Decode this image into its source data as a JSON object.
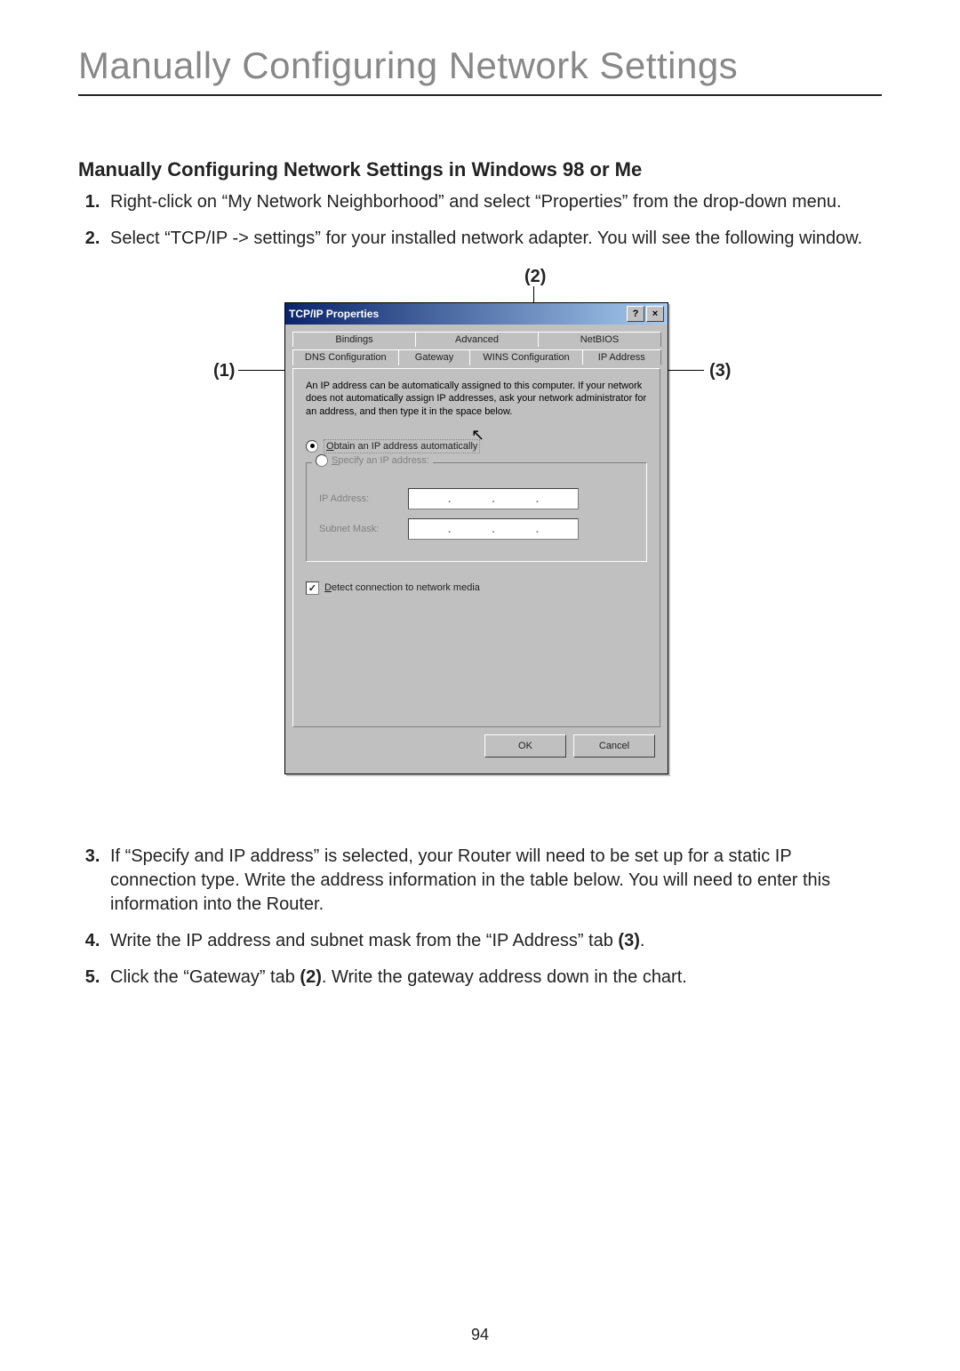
{
  "page": {
    "title": "Manually Configuring Network Settings",
    "heading": "Manually Configuring Network Settings in Windows 98 or Me",
    "page_number": "94"
  },
  "steps": {
    "s1": "Right-click on “My Network Neighborhood” and select “Properties” from the drop-down menu.",
    "s2": "Select “TCP/IP -> settings” for your installed network adapter. You will see the following window.",
    "s3_a": "If “Specify and IP address” is selected, your Router will need to be set up for a static IP connection type. Write the address information in the table below. You will need to enter this information into the Router.",
    "s4_a": "Write the IP address and subnet mask from the “IP Address” tab ",
    "s4_b": "(3)",
    "s4_c": ".",
    "s5_a": "Click the “Gateway” tab ",
    "s5_b": "(2)",
    "s5_c": ". Write the gateway address down in the chart."
  },
  "callouts": {
    "c1": "(1)",
    "c2": "(2)",
    "c3": "(3)"
  },
  "dialog": {
    "title": "TCP/IP Properties",
    "help_btn": "?",
    "close_btn": "×",
    "tabs_back": {
      "bindings": "Bindings",
      "advanced": "Advanced",
      "netbios": "NetBIOS"
    },
    "tabs_front": {
      "dns": "DNS Configuration",
      "gateway": "Gateway",
      "wins": "WINS Configuration",
      "ipaddr": "IP Address"
    },
    "info": "An IP address can be automatically assigned to this computer. If your network does not automatically assign IP addresses, ask your network administrator for an address, and then type it in the space below.",
    "radio_auto_pre": "O",
    "radio_auto_rest": "btain an IP address automatically",
    "radio_spec_pre": "S",
    "radio_spec_rest": "pecify an IP address:",
    "ip_label": "IP Address:",
    "mask_label": "Subnet Mask:",
    "detect_pre": "D",
    "detect_rest": "etect connection to network media",
    "check_mark": "✓",
    "ok": "OK",
    "cancel": "Cancel",
    "dot": "."
  }
}
